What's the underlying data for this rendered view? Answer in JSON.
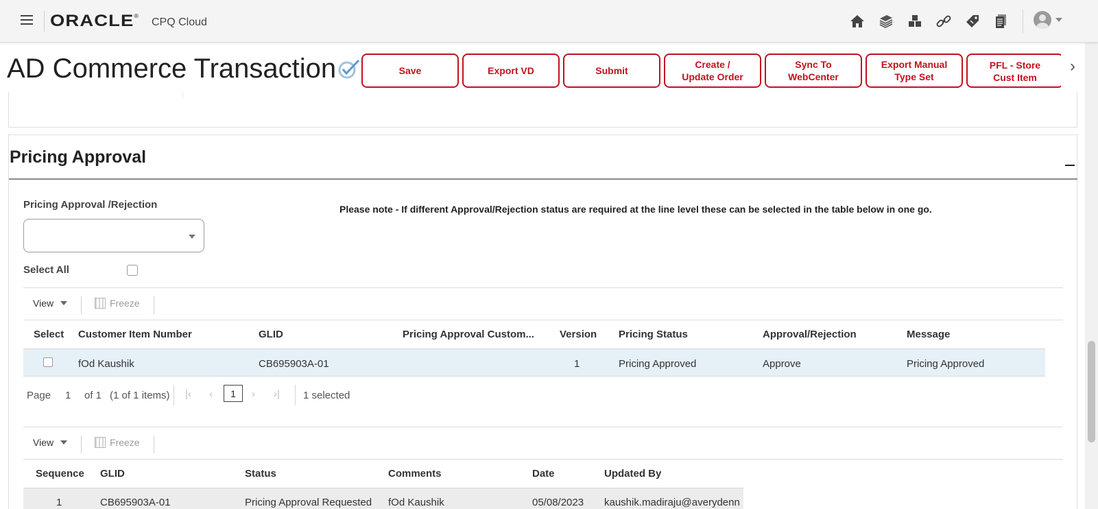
{
  "app": {
    "brand": "ORACLE",
    "brand_mark": "®",
    "product": "CPQ Cloud"
  },
  "top_icons": [
    "home-icon",
    "stack-icon",
    "blocks-icon",
    "link-icon",
    "tag-icon",
    "documents-icon"
  ],
  "header": {
    "title": "AD Commerce Transaction",
    "actions": [
      "Save",
      "Export VD",
      "Submit",
      "Create /\nUpdate Order",
      "Sync To\nWebCenter",
      "Export Manual\nType Set",
      "PFL - Store\nCust Item\nExcel Template"
    ]
  },
  "section": {
    "title": "Pricing Approval",
    "field_label": "Pricing Approval /Rejection",
    "field_value": "",
    "note": "Please note - If different Approval/Rejection status are required at the line level these can be selected in the table below in one go.",
    "select_all_label": "Select All"
  },
  "toolbar": {
    "view": "View",
    "freeze": "Freeze"
  },
  "table1": {
    "columns": [
      "Select",
      "Customer Item Number",
      "GLID",
      "Pricing Approval Custom...",
      "Version",
      "Pricing Status",
      "Approval/Rejection",
      "Message"
    ],
    "rows": [
      {
        "customer_item": "fOd Kaushik",
        "glid": "CB695903A-01",
        "custom": "",
        "version": "1",
        "pricing_status": "Pricing Approved",
        "approval": "Approve",
        "message": "Pricing Approved"
      }
    ]
  },
  "pager": {
    "page_label": "Page",
    "page_value": "1",
    "of": "of 1",
    "items": "(1 of 1 items)",
    "current": "1",
    "selected": "1 selected"
  },
  "table2": {
    "columns": [
      "Sequence",
      "GLID",
      "Status",
      "Comments",
      "Date",
      "Updated By"
    ],
    "rows": [
      {
        "sequence": "1",
        "glid": "CB695903A-01",
        "status": "Pricing Approval Requested",
        "comments": "fOd Kaushik",
        "date": "05/08/2023",
        "updated_by": "kaushik.madiraju@averydenn"
      }
    ]
  },
  "colors": {
    "accent_red": "#c0121f",
    "selected_row": "#e6f0f7"
  }
}
